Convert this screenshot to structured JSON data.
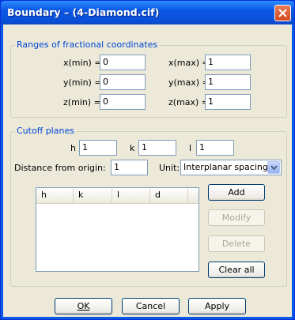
{
  "window": {
    "title": "Boundary – (4-Diamond.cif)"
  },
  "ranges": {
    "label": "Ranges of fractional coordinates",
    "xmin_label": "x(min) =",
    "xmin": "0",
    "xmax_label": "x(max) =",
    "xmax": "1",
    "ymin_label": "y(min) =",
    "ymin": "0",
    "ymax_label": "y(max) =",
    "ymax": "1",
    "zmin_label": "z(min) =",
    "zmin": "0",
    "zmax_label": "z(max) =",
    "zmax": "1"
  },
  "cutoff": {
    "label": "Cutoff planes",
    "h_label": "h",
    "h": "1",
    "k_label": "k",
    "k": "1",
    "l_label": "l",
    "l": "1",
    "distance_label": "Distance from origin:",
    "distance": "1",
    "unit_label": "Unit:",
    "unit_value": "Interplanar spacing",
    "columns": [
      "h",
      "k",
      "l",
      "d"
    ],
    "add": "Add",
    "modify": "Modify",
    "delete": "Delete",
    "clear_all": "Clear all"
  },
  "footer": {
    "ok": "OK",
    "cancel": "Cancel",
    "apply": "Apply"
  },
  "icons": {
    "close": "close-icon",
    "dropdown": "chevron-down-icon"
  },
  "colors": {
    "group_label": "#0046d5",
    "titlebar": "#0a58e4",
    "close": "#d6481b",
    "dialog_bg": "#ece9d8"
  }
}
